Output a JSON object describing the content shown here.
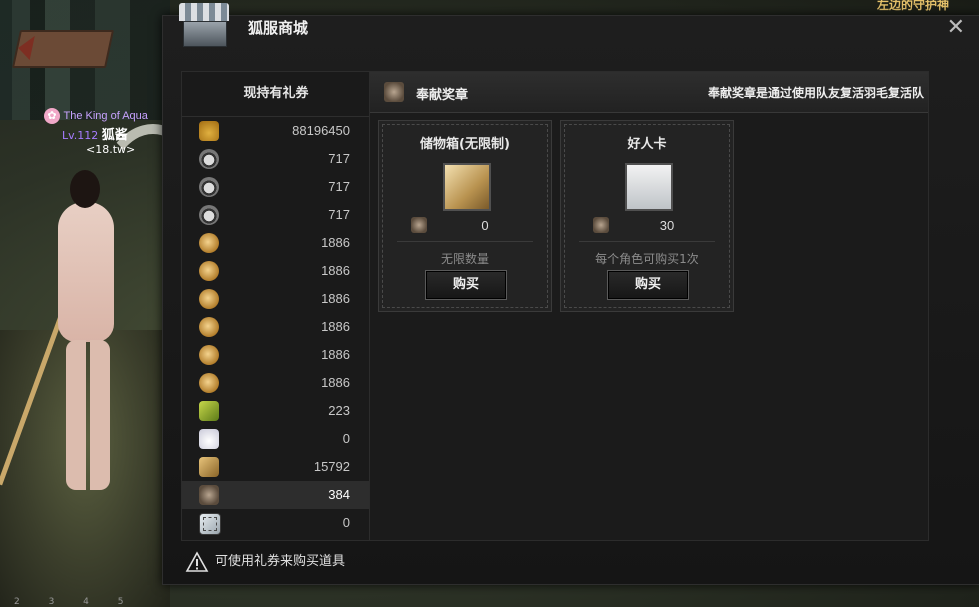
{
  "scene": {
    "guild_name": "The King of Aqua",
    "level": "Lv.112",
    "player_name": "狐酱",
    "player_tag": "<18.tw>",
    "topright_text": "左边的守护神",
    "hotbar": "2 3 4 5"
  },
  "window": {
    "title": "狐服商城",
    "close_glyph": "✕"
  },
  "left_panel": {
    "header": "现持有礼券",
    "coupons": [
      {
        "icon": "bell-icon",
        "value": "88196450"
      },
      {
        "icon": "bowl-icon",
        "value": "717"
      },
      {
        "icon": "bowl-icon",
        "value": "717"
      },
      {
        "icon": "bowl-icon",
        "value": "717"
      },
      {
        "icon": "coin-icon",
        "value": "1886"
      },
      {
        "icon": "coin-icon",
        "value": "1886"
      },
      {
        "icon": "coin-icon",
        "value": "1886"
      },
      {
        "icon": "coin-icon",
        "value": "1886"
      },
      {
        "icon": "coin-icon",
        "value": "1886"
      },
      {
        "icon": "coin-icon",
        "value": "1886"
      },
      {
        "icon": "ticket-icon",
        "value": "223"
      },
      {
        "icon": "cream-icon",
        "value": "0"
      },
      {
        "icon": "box-icon",
        "value": "15792"
      },
      {
        "icon": "medal-icon",
        "value": "384",
        "selected": true
      },
      {
        "icon": "card-icon",
        "value": "0"
      }
    ]
  },
  "category": {
    "name": "奉献奖章",
    "description": "奉献奖章是通过使用队友复活羽毛复活队"
  },
  "items": [
    {
      "name": "储物箱(无限制)",
      "icon": "scroll-icon",
      "price": "0",
      "limit": "无限数量",
      "buy_label": "购买"
    },
    {
      "name": "好人卡",
      "icon": "good-person-card-icon",
      "price": "30",
      "limit": "每个角色可购买1次",
      "buy_label": "购买"
    }
  ],
  "footer": {
    "notice": "可使用礼券来购买道具"
  }
}
